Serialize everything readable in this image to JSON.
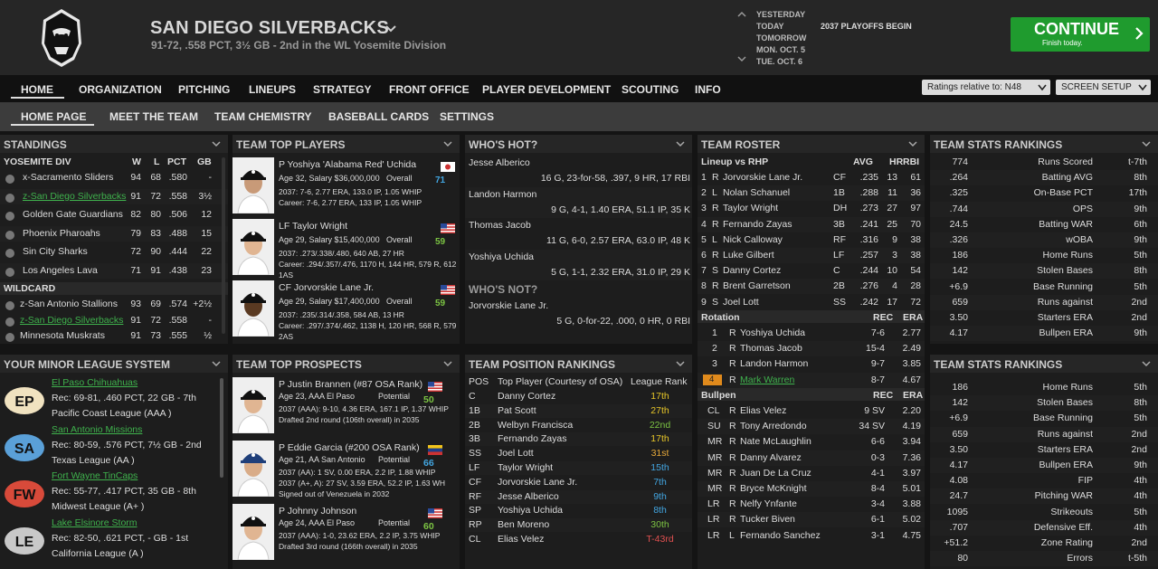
{
  "team": {
    "name": "SAN DIEGO SILVERBACKS",
    "record": "91-72, .558 PCT, 3½ GB - 2nd in the WL Yosemite Division"
  },
  "calendar": {
    "items": [
      "YESTERDAY",
      "TODAY",
      "TOMORROW",
      "MON. OCT. 5",
      "TUE. OCT. 6"
    ],
    "event": "2037 PLAYOFFS BEGIN"
  },
  "continue": {
    "label": "CONTINUE",
    "sub": "Finish today."
  },
  "nav": [
    "HOME",
    "ORGANIZATION",
    "PITCHING",
    "LINEUPS",
    "STRATEGY",
    "FRONT OFFICE",
    "PLAYER DEVELOPMENT",
    "SCOUTING",
    "INFO"
  ],
  "ratings_select": "Ratings relative to: N48",
  "screen_setup": "SCREEN SETUP",
  "subnav": [
    "HOME PAGE",
    "MEET THE TEAM",
    "TEAM CHEMISTRY",
    "BASEBALL CARDS",
    "SETTINGS"
  ],
  "standings": {
    "title": "STANDINGS",
    "cols": [
      "W",
      "L",
      "PCT",
      "GB"
    ],
    "div": "YOSEMITE DIV",
    "wc": "WILDCARD",
    "division": [
      [
        "x-Sacramento Sliders",
        "94",
        "68",
        ".580",
        "-"
      ],
      [
        "z-San Diego Silverbacks",
        "91",
        "72",
        ".558",
        "3½"
      ],
      [
        "Golden Gate Guardians",
        "82",
        "80",
        ".506",
        "12"
      ],
      [
        "Phoenix Pharoahs",
        "79",
        "83",
        ".488",
        "15"
      ],
      [
        "Sin City Sharks",
        "72",
        "90",
        ".444",
        "22"
      ],
      [
        "Los Angeles Lava",
        "71",
        "91",
        ".438",
        "23"
      ]
    ],
    "wildcard": [
      [
        "z-San Antonio Stallions",
        "93",
        "69",
        ".574",
        "+2½"
      ],
      [
        "z-San Diego Silverbacks",
        "91",
        "72",
        ".558",
        "-"
      ],
      [
        "Minnesota Muskrats",
        "91",
        "73",
        ".555",
        "½"
      ]
    ]
  },
  "top_players": {
    "title": "TEAM TOP PLAYERS",
    "players": [
      {
        "name": "P Yoshiya 'Alabama Red' Uchida",
        "info": "Age 32, Salary $36,000,000",
        "ovr_label": "Overall",
        "ovr": "71",
        "l1": "2037: 7-6, 2.77 ERA, 133.0 IP, 1.05 WHIP",
        "l2": "Career: 7-6, 2.77 ERA, 133 IP, 1.05 WHIP"
      },
      {
        "name": "LF Taylor Wright",
        "info": "Age 29, Salary $15,400,000",
        "ovr_label": "Overall",
        "ovr": "59",
        "l1": "2037: .273/.338/.480, 640 AB, 27 HR",
        "l2": "Career: .294/.357/.476, 1170 H, 144 HR, 579 R, 612",
        "l3": "1AS"
      },
      {
        "name": "CF Jorvorskie Lane Jr.",
        "info": "Age 29, Salary $17,400,000",
        "ovr_label": "Overall",
        "ovr": "59",
        "l1": "2037: .235/.314/.358, 584 AB, 13 HR",
        "l2": "Career: .297/.374/.462, 1138 H, 120 HR, 568 R, 579",
        "l3": "2AS"
      }
    ]
  },
  "whos_hot": {
    "title": "WHO'S HOT?",
    "rows": [
      [
        "Jesse Alberico",
        "16 G, 23-for-58, .397, 9 HR, 17 RBI"
      ],
      [
        "Landon Harmon",
        "9 G, 4-1, 1.40 ERA, 51.1 IP, 35 K"
      ],
      [
        "Thomas Jacob",
        "11 G, 6-0, 2.57 ERA, 63.0 IP, 48 K"
      ],
      [
        "Yoshiya Uchida",
        "5 G, 1-1, 2.32 ERA, 31.0 IP, 29 K"
      ]
    ],
    "not_title": "WHO'S NOT?",
    "not": [
      [
        "Jorvorskie Lane Jr.",
        "5 G, 0-for-22, .000, 0 HR, 0 RBI"
      ]
    ]
  },
  "roster": {
    "title": "TEAM ROSTER",
    "lineup_hdr": "Lineup vs RHP",
    "cols": [
      "AVG",
      "HR",
      "RBI"
    ],
    "lineup": [
      [
        "1",
        "R",
        "Jorvorskie Lane Jr.",
        "CF",
        ".235",
        "13",
        "61"
      ],
      [
        "2",
        "L",
        "Nolan Schanuel",
        "1B",
        ".288",
        "11",
        "36"
      ],
      [
        "3",
        "R",
        "Taylor Wright",
        "DH",
        ".273",
        "27",
        "97"
      ],
      [
        "4",
        "R",
        "Fernando Zayas",
        "3B",
        ".241",
        "25",
        "70"
      ],
      [
        "5",
        "L",
        "Nick Calloway",
        "RF",
        ".316",
        "9",
        "38"
      ],
      [
        "6",
        "R",
        "Luke Gilbert",
        "LF",
        ".257",
        "3",
        "38"
      ],
      [
        "7",
        "S",
        "Danny Cortez",
        "C",
        ".244",
        "10",
        "54"
      ],
      [
        "8",
        "R",
        "Brent Garretson",
        "2B",
        ".276",
        "4",
        "28"
      ],
      [
        "9",
        "S",
        "Joel Lott",
        "SS",
        ".242",
        "17",
        "72"
      ]
    ],
    "rot_hdr": "Rotation",
    "rot_cols": [
      "REC",
      "ERA"
    ],
    "rotation": [
      [
        "1",
        "R",
        "Yoshiya Uchida",
        "7-6",
        "2.77"
      ],
      [
        "2",
        "R",
        "Thomas Jacob",
        "15-4",
        "2.49"
      ],
      [
        "3",
        "R",
        "Landon Harmon",
        "9-7",
        "3.85"
      ],
      [
        "4",
        "R",
        "Mark Warren",
        "8-7",
        "4.67"
      ]
    ],
    "pen_hdr": "Bullpen",
    "pen_cols": [
      "REC",
      "ERA"
    ],
    "bullpen": [
      [
        "CL",
        "R",
        "Elias Velez",
        "9 SV",
        "2.20"
      ],
      [
        "SU",
        "R",
        "Tony Arredondo",
        "34 SV",
        "4.19"
      ],
      [
        "MR",
        "R",
        "Nate McLaughlin",
        "6-6",
        "3.94"
      ],
      [
        "MR",
        "R",
        "Danny Alvarez",
        "0-3",
        "7.36"
      ],
      [
        "MR",
        "R",
        "Juan De La Cruz",
        "4-1",
        "3.97"
      ],
      [
        "MR",
        "R",
        "Bryce McKnight",
        "8-4",
        "5.01"
      ],
      [
        "LR",
        "R",
        "Nelfy Ynfante",
        "3-4",
        "3.88"
      ],
      [
        "LR",
        "R",
        "Tucker Biven",
        "6-1",
        "5.02"
      ],
      [
        "LR",
        "L",
        "Fernando Sanchez",
        "3-1",
        "4.75"
      ]
    ]
  },
  "stats1": {
    "title": "TEAM STATS RANKINGS",
    "rows": [
      [
        "774",
        "Runs Scored",
        "t-7th"
      ],
      [
        ".264",
        "Batting AVG",
        "8th"
      ],
      [
        ".325",
        "On-Base PCT",
        "17th"
      ],
      [
        ".744",
        "OPS",
        "9th"
      ],
      [
        "24.5",
        "Batting WAR",
        "6th"
      ],
      [
        ".326",
        "wOBA",
        "9th"
      ],
      [
        "186",
        "Home Runs",
        "5th"
      ],
      [
        "142",
        "Stolen Bases",
        "8th"
      ],
      [
        "+6.9",
        "Base Running",
        "5th"
      ],
      [
        "659",
        "Runs against",
        "2nd"
      ],
      [
        "3.50",
        "Starters ERA",
        "2nd"
      ],
      [
        "4.17",
        "Bullpen ERA",
        "9th"
      ],
      [
        "4.08",
        "FIP",
        "4th"
      ]
    ]
  },
  "stats2": {
    "title": "TEAM STATS RANKINGS",
    "rows": [
      [
        "186",
        "Home Runs",
        "5th"
      ],
      [
        "142",
        "Stolen Bases",
        "8th"
      ],
      [
        "+6.9",
        "Base Running",
        "5th"
      ],
      [
        "659",
        "Runs against",
        "2nd"
      ],
      [
        "3.50",
        "Starters ERA",
        "2nd"
      ],
      [
        "4.17",
        "Bullpen ERA",
        "9th"
      ],
      [
        "4.08",
        "FIP",
        "4th"
      ],
      [
        "24.7",
        "Pitching WAR",
        "4th"
      ],
      [
        "1095",
        "Strikeouts",
        "5th"
      ],
      [
        ".707",
        "Defensive Eff.",
        "4th"
      ],
      [
        "+51.2",
        "Zone Rating",
        "2nd"
      ],
      [
        "80",
        "Errors",
        "t-5th"
      ]
    ]
  },
  "minors": {
    "title": "YOUR MINOR LEAGUE SYSTEM",
    "teams": [
      {
        "name": "El Paso Chihuahuas",
        "rec": "Rec: 69-81, .460 PCT, 22 GB - 7th",
        "league": "Pacific Coast League (AAA )",
        "abbr": "EP"
      },
      {
        "name": "San Antonio Missions",
        "rec": "Rec: 80-59, .576 PCT, 7½ GB - 2nd",
        "league": "Texas League (AA )",
        "abbr": "SA"
      },
      {
        "name": "Fort Wayne TinCaps",
        "rec": "Rec: 55-77, .417 PCT, 35 GB - 8th",
        "league": "Midwest League (A+ )",
        "abbr": "FW"
      },
      {
        "name": "Lake Elsinore Storm",
        "rec": "Rec: 82-50, .621 PCT, - GB - 1st",
        "league": "California League (A )",
        "abbr": "LE"
      }
    ]
  },
  "prospects": {
    "title": "TEAM TOP PROSPECTS",
    "players": [
      {
        "name": "P Justin Brannen (#87 OSA Rank)",
        "info": "Age 23, AAA El Paso",
        "pot_label": "Potential",
        "pot": "50",
        "l1": "2037 (AAA): 9-10, 4.36 ERA, 167.1 IP, 1.37 WHIP",
        "l2": "Drafted 2nd round (106th overall) in 2035"
      },
      {
        "name": "P Eddie Garcia (#200 OSA Rank)",
        "info": "Age 21, AA San Antonio",
        "pot_label": "Potential",
        "pot": "66",
        "l1": "2037 (AA): 1 SV, 0.00 ERA, 2.2 IP, 1.88 WHIP",
        "l2": "2037 (A+, A): 27 SV, 3.59 ERA, 52.2 IP, 1.63 WH",
        "l3": "Signed out of Venezuela in 2032"
      },
      {
        "name": "P Johnny Johnson",
        "info": "Age 24, AAA El Paso",
        "pot_label": "Potential",
        "pot": "60",
        "l1": "2037 (AAA): 1-0, 23.62 ERA, 2.2 IP, 3.75 WHIP",
        "l2": "Drafted 3rd round (166th overall) in 2035"
      }
    ]
  },
  "pos_rank": {
    "title": "TEAM POSITION RANKINGS",
    "cols": [
      "POS",
      "Top Player (Courtesy of OSA)",
      "League Rank"
    ],
    "rows": [
      [
        "C",
        "Danny Cortez",
        "17th"
      ],
      [
        "1B",
        "Pat Scott",
        "27th"
      ],
      [
        "2B",
        "Welbyn Francisca",
        "22nd"
      ],
      [
        "3B",
        "Fernando Zayas",
        "17th"
      ],
      [
        "SS",
        "Joel Lott",
        "31st"
      ],
      [
        "LF",
        "Taylor Wright",
        "15th"
      ],
      [
        "CF",
        "Jorvorskie Lane Jr.",
        "7th"
      ],
      [
        "RF",
        "Jesse Alberico",
        "9th"
      ],
      [
        "SP",
        "Yoshiya Uchida",
        "8th"
      ],
      [
        "RP",
        "Ben Moreno",
        "30th"
      ],
      [
        "CL",
        "Elias Velez",
        "T-43rd"
      ]
    ]
  },
  "colors": {
    "accent_green": "#1f9b2e",
    "link_green": "#3fb24d",
    "rank_yellow": "#e7c628",
    "rank_green": "#7cc443",
    "rank_blue": "#42a5e0",
    "rank_orange": "#e7a93a",
    "rank_red": "#e05050",
    "injured_badge": "#e08a1c"
  },
  "icons": [
    "gorilla-logo-icon",
    "chevron-down-icon",
    "chevron-up-icon",
    "chevron-right-icon",
    "flag-japan-icon",
    "flag-usa-icon",
    "flag-venezuela-icon"
  ]
}
